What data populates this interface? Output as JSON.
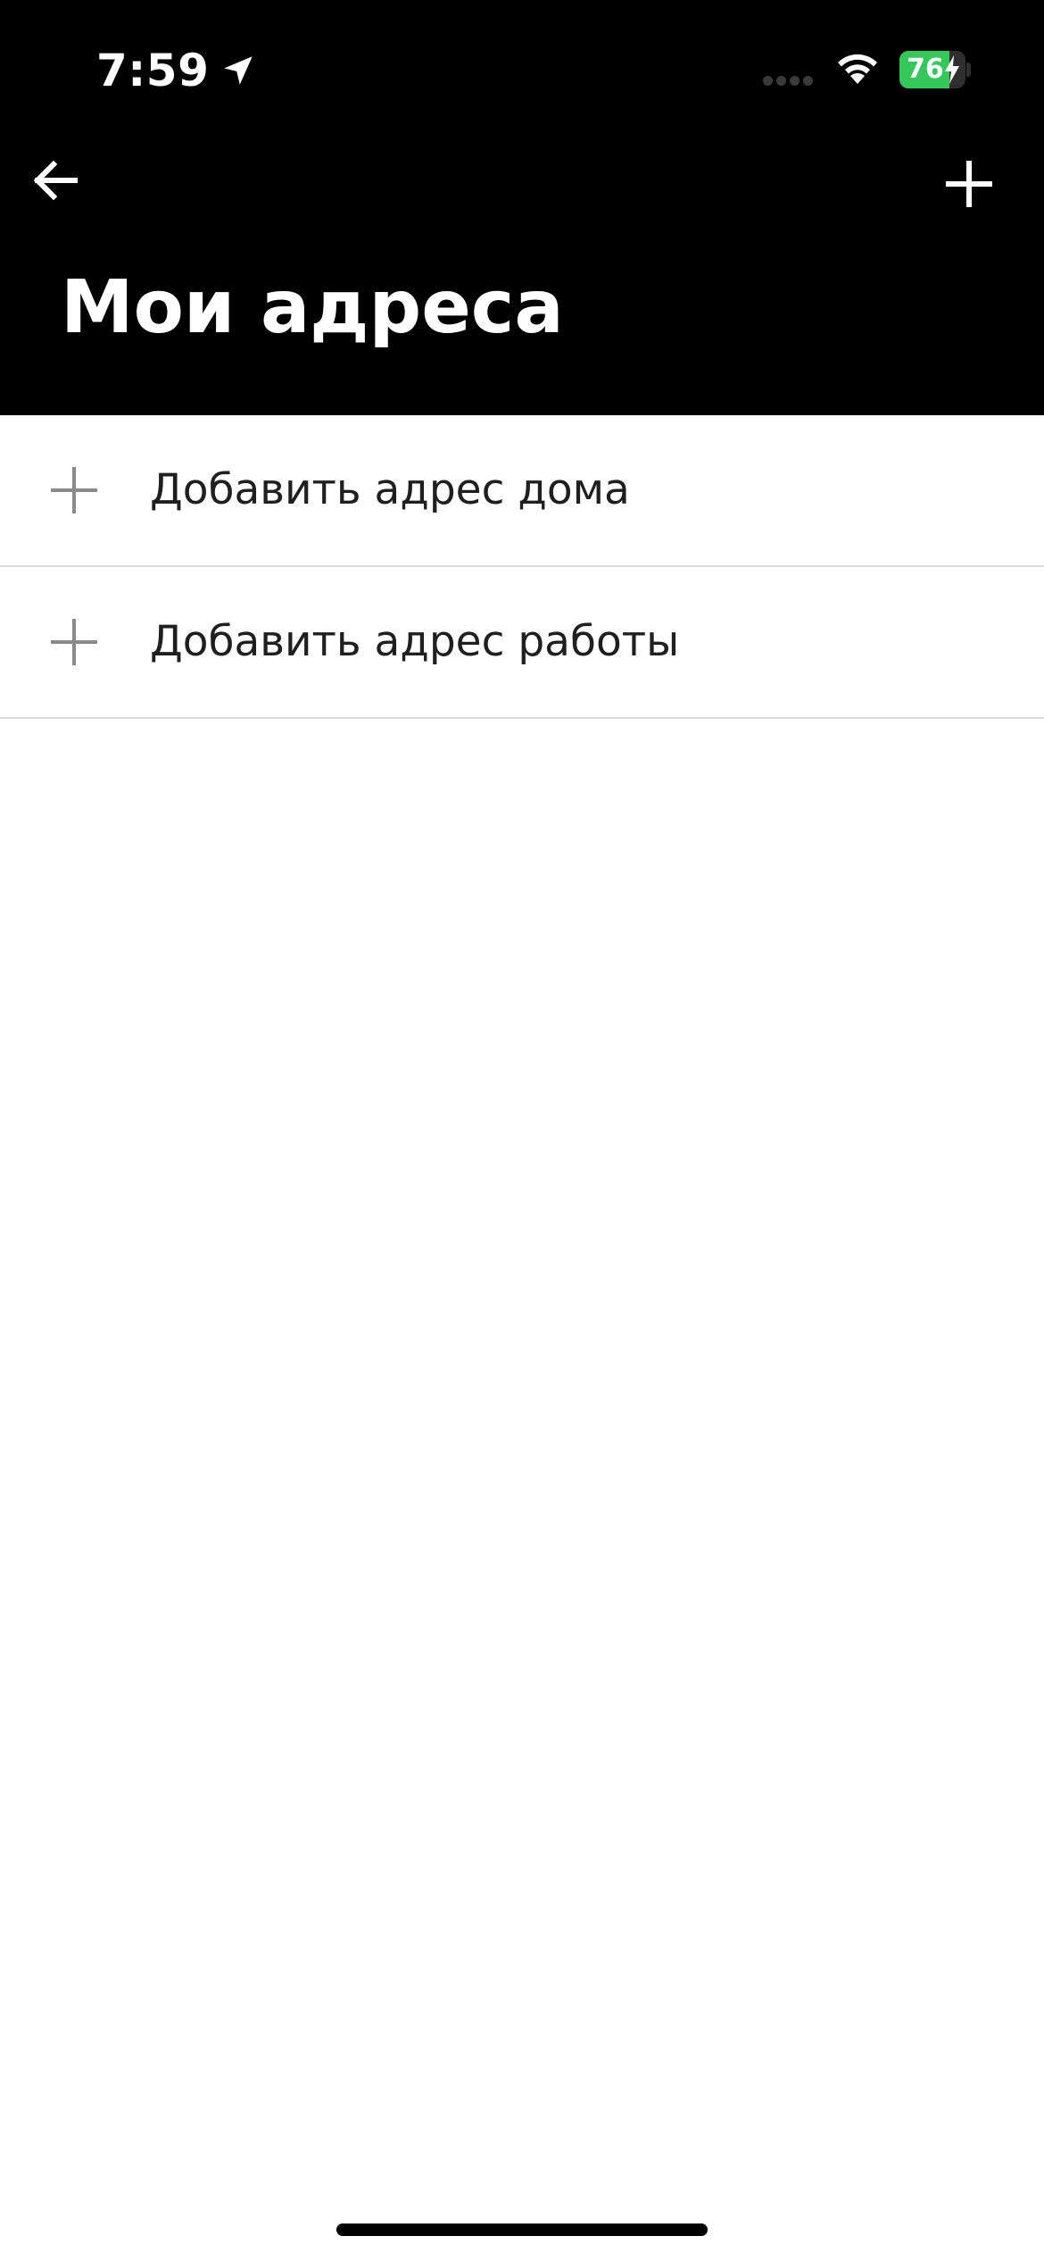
{
  "status_bar": {
    "time": "7:59",
    "battery_level": "76",
    "battery_fraction": 0.76,
    "battery_color": "#34c759"
  },
  "nav": {
    "back_icon": "arrow-left-icon",
    "add_icon": "plus-icon"
  },
  "page": {
    "title": "Мои адреса"
  },
  "addresses": [
    {
      "label": "Добавить адрес дома",
      "icon": "plus-icon"
    },
    {
      "label": "Добавить адрес работы",
      "icon": "plus-icon"
    }
  ]
}
